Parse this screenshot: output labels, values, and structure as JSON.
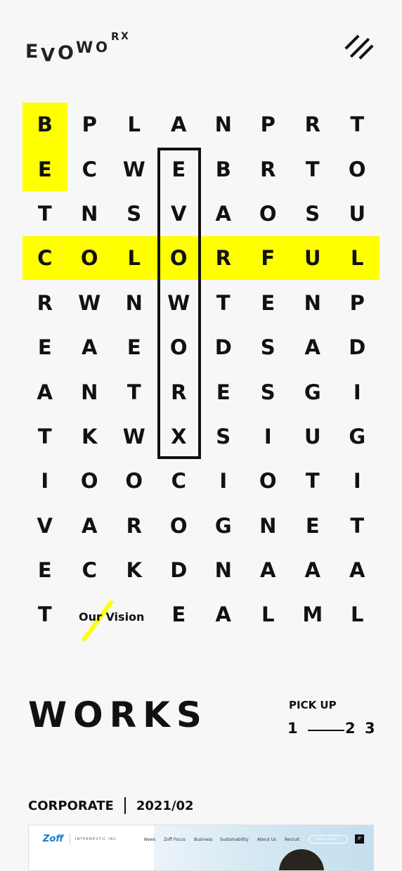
{
  "logo": {
    "text": "EVOWORX",
    "letters": [
      "E",
      "V",
      "O",
      "W",
      "O",
      "R",
      "X"
    ]
  },
  "grid": {
    "rows": [
      [
        "B",
        "P",
        "L",
        "A",
        "N",
        "P",
        "R",
        "T"
      ],
      [
        "E",
        "C",
        "W",
        "E",
        "B",
        "R",
        "T",
        "O"
      ],
      [
        "T",
        "N",
        "S",
        "V",
        "A",
        "O",
        "S",
        "U"
      ],
      [
        "C",
        "O",
        "L",
        "O",
        "R",
        "F",
        "U",
        "L"
      ],
      [
        "R",
        "W",
        "N",
        "W",
        "T",
        "E",
        "N",
        "P"
      ],
      [
        "E",
        "A",
        "E",
        "O",
        "D",
        "S",
        "A",
        "D"
      ],
      [
        "A",
        "N",
        "T",
        "R",
        "E",
        "S",
        "G",
        "I"
      ],
      [
        "T",
        "K",
        "W",
        "X",
        "S",
        "I",
        "U",
        "G"
      ],
      [
        "I",
        "O",
        "O",
        "C",
        "I",
        "O",
        "T",
        "I"
      ],
      [
        "V",
        "A",
        "R",
        "O",
        "G",
        "N",
        "E",
        "T"
      ],
      [
        "E",
        "C",
        "K",
        "D",
        "N",
        "A",
        "A",
        "A"
      ],
      [
        "T",
        "",
        "",
        "E",
        "A",
        "L",
        "M",
        "L"
      ]
    ],
    "highlight_color": "#ffff00"
  },
  "vision_link": "Our Vision",
  "works": {
    "title": "WORKS",
    "pickup_label": "PICK UP",
    "pages": [
      "1",
      "2",
      "3"
    ]
  },
  "item": {
    "category": "CORPORATE",
    "date": "2021/02"
  },
  "preview": {
    "brand": "Zoff",
    "company": "INTERMESTIC INC.",
    "nav": [
      "News",
      "Zoff Focus",
      "Business",
      "Sustainability",
      "About Us",
      "Recruit"
    ],
    "shop_button": "Online Shop ↗",
    "lang": "JP"
  }
}
